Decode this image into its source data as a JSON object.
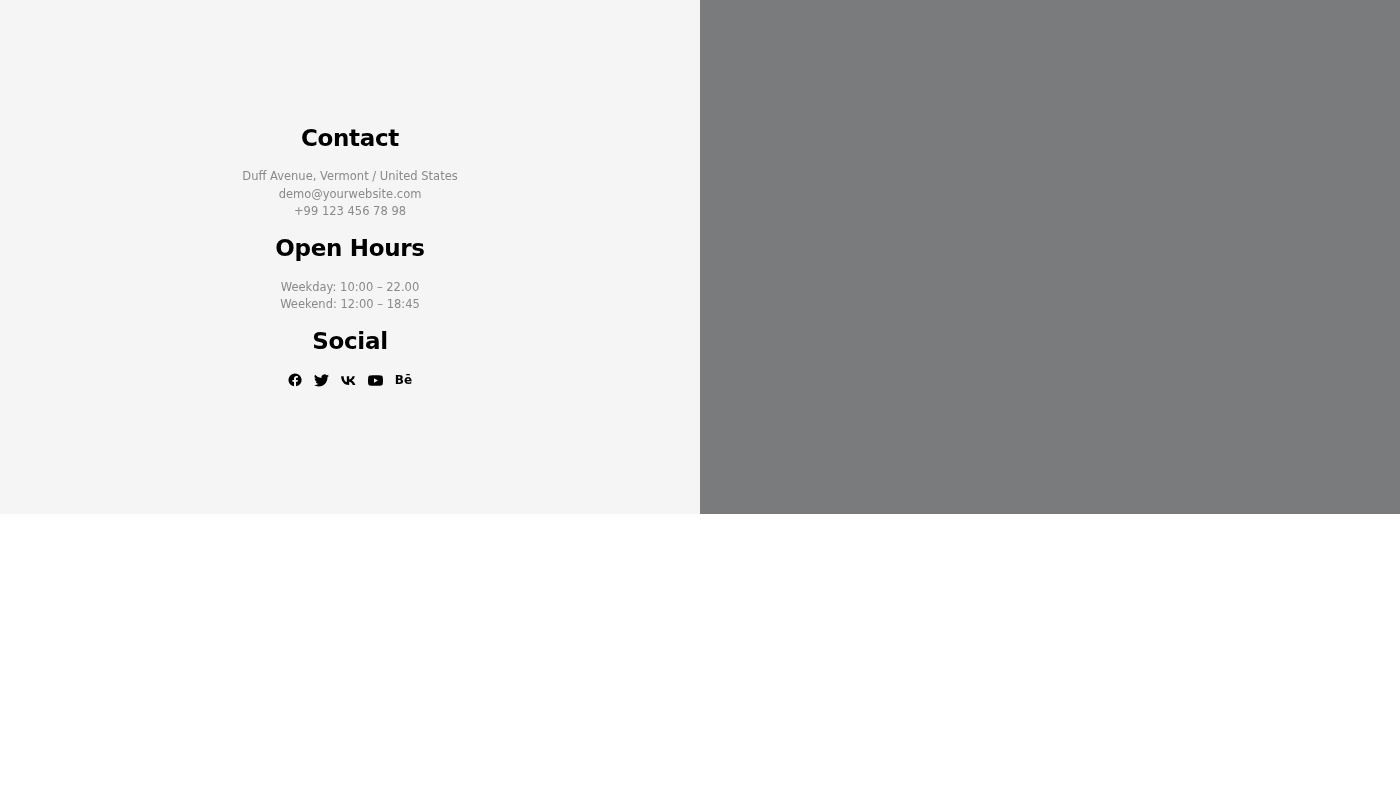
{
  "sections": [
    {
      "kind": "lines",
      "title": "Contact",
      "lines": [
        "Duff Avenue, Vermont / United States",
        "demo@yourwebsite.com",
        "+99 123 456 78 98"
      ]
    },
    {
      "kind": "lines",
      "title": "Open Hours",
      "lines": [
        "Weekday: 10:00 – 22.00",
        "Weekend: 12:00 – 18:45"
      ]
    },
    {
      "kind": "social",
      "title": "Social",
      "icons": [
        {
          "kind": "facebook"
        },
        {
          "kind": "twitter"
        },
        {
          "kind": "vk"
        },
        {
          "kind": "youtube"
        },
        {
          "kind": "behance",
          "text": "Bē"
        }
      ]
    }
  ]
}
